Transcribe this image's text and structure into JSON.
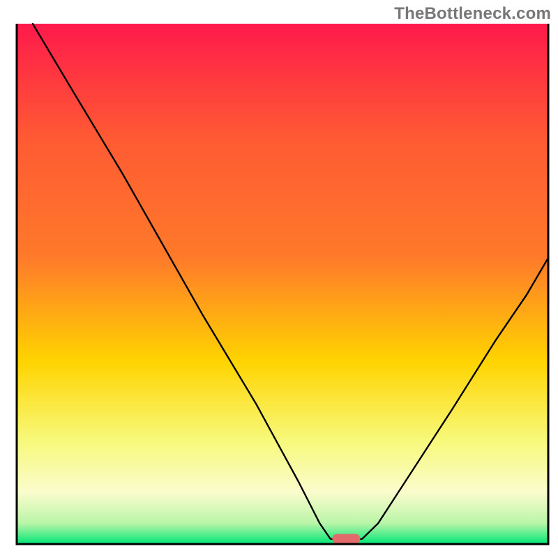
{
  "watermark": "TheBottleneck.com",
  "chart_data": {
    "type": "line",
    "title": "",
    "xlabel": "",
    "ylabel": "",
    "xlim": [
      0,
      100
    ],
    "ylim": [
      0,
      100
    ],
    "grid": false,
    "annotations": [],
    "gradient_background": {
      "top_color": "#ff1a4b",
      "upper_mid_color": "#ff7a2a",
      "mid_color": "#ffd400",
      "lower_mid_color": "#f7f97a",
      "pale_band_color": "#fbfccc",
      "bottom_color": "#00e676"
    },
    "marker": {
      "x": 62,
      "y": 1,
      "color": "#e26a6a",
      "shape": "pill"
    },
    "curve_points": [
      {
        "x": 3,
        "y": 100
      },
      {
        "x": 10,
        "y": 88
      },
      {
        "x": 20,
        "y": 71
      },
      {
        "x": 25,
        "y": 62
      },
      {
        "x": 35,
        "y": 44
      },
      {
        "x": 45,
        "y": 27
      },
      {
        "x": 53,
        "y": 12
      },
      {
        "x": 57,
        "y": 4
      },
      {
        "x": 59,
        "y": 1
      },
      {
        "x": 62,
        "y": 0.5
      },
      {
        "x": 65,
        "y": 1
      },
      {
        "x": 68,
        "y": 4
      },
      {
        "x": 75,
        "y": 15
      },
      {
        "x": 82,
        "y": 26
      },
      {
        "x": 90,
        "y": 39
      },
      {
        "x": 96,
        "y": 48
      },
      {
        "x": 100,
        "y": 55
      }
    ]
  }
}
